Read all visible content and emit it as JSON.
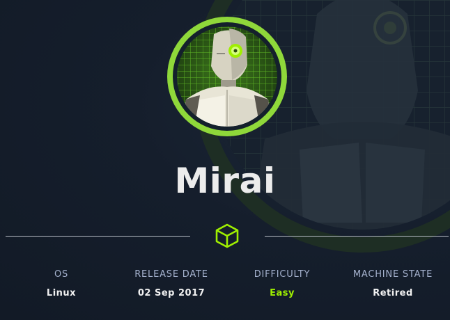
{
  "machine": {
    "name": "Mirai"
  },
  "info": [
    {
      "label": "OS",
      "value": "Linux"
    },
    {
      "label": "RELEASE DATE",
      "value": "02 Sep 2017"
    },
    {
      "label": "DIFFICULTY",
      "value": "Easy"
    },
    {
      "label": "MACHINE STATE",
      "value": "Retired"
    }
  ],
  "colors": {
    "background": "#141d2b",
    "accent_green": "#9fef00",
    "label": "#a4b1cd",
    "value": "#f2f2f2",
    "difficulty_easy": "#9fef00"
  },
  "icons": {
    "avatar": "robot-avatar",
    "divider": "cube-icon"
  }
}
